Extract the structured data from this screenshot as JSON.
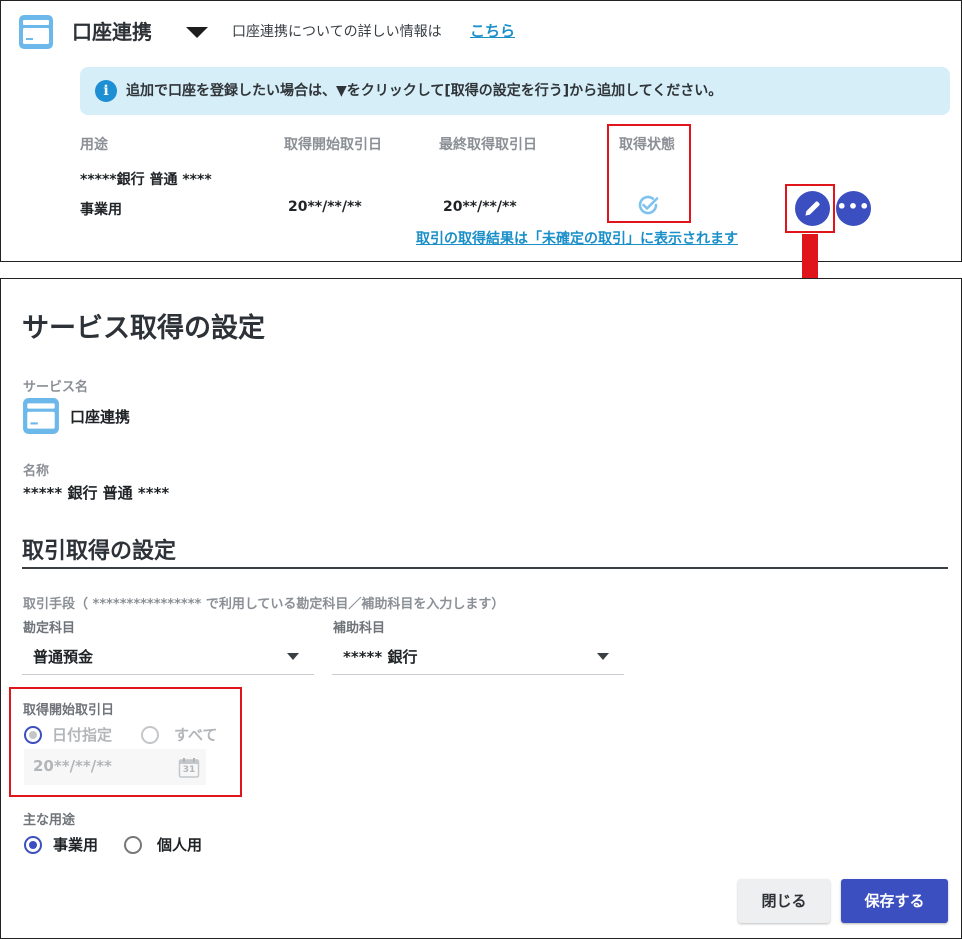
{
  "top": {
    "service_title": "口座連携",
    "description": "口座連携についての詳しい情報は",
    "link_label": "こちら",
    "info_icon_glyph": "i",
    "info_message": "追加で口座を登録したい場合は、▼をクリックして[取得の設定を行う]から追加してください。",
    "columns": [
      "用途",
      "取得開始取引日",
      "最終取得取引日",
      "取得状態"
    ],
    "account_name": "*****銀行 普通 ****",
    "row": {
      "usage": "事業用",
      "start_date": "20**/**/**",
      "last_date": "20**/**/**",
      "status_icon": "check-circle-icon"
    },
    "more_glyph": "•••",
    "footer_link": "取引の取得結果は「未確定の取引」に表示されます"
  },
  "dialog": {
    "title": "サービス取得の設定",
    "service_label": "サービス名",
    "service_name": "口座連携",
    "name_label": "名称",
    "name_value": "***** 銀行 普通 ****",
    "section_title": "取引取得の設定",
    "method_note": "取引手段（ **************** で利用している勘定科目／補助科目を入力します）",
    "account_label": "勘定科目",
    "account_value": "普通預金",
    "sub_account_label": "補助科目",
    "sub_account_value": "***** 銀行",
    "start_label": "取得開始取引日",
    "radio_specify": "日付指定",
    "radio_all": "すべて",
    "start_date_value": "20**/**/**",
    "calendar_day": "31",
    "usage_label": "主な用途",
    "usage_business": "事業用",
    "usage_personal": "個人用",
    "close_label": "閉じる",
    "save_label": "保存する"
  },
  "colors": {
    "accent": "#3b4fc0",
    "link": "#1a8fc9",
    "highlight": "#e0141b",
    "info_bg": "#d6eef8",
    "icon_blue": "#5ab0e6"
  }
}
